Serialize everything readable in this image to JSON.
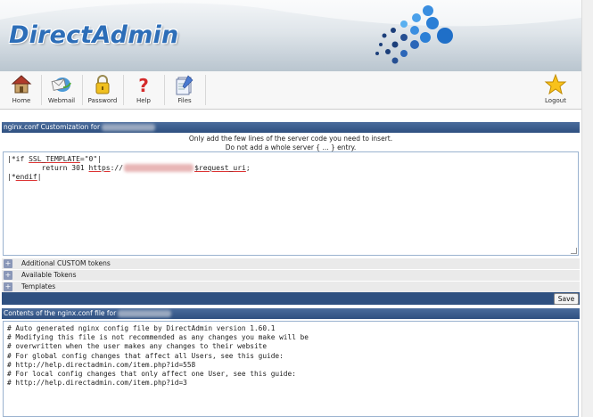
{
  "header": {
    "logo_text": "DirectAdmin"
  },
  "toolbar": {
    "items": [
      {
        "label": "Home",
        "icon": "home-icon"
      },
      {
        "label": "Webmail",
        "icon": "webmail-icon"
      },
      {
        "label": "Password",
        "icon": "padlock-icon"
      },
      {
        "label": "Help",
        "icon": "question-icon"
      },
      {
        "label": "Files",
        "icon": "files-icon"
      }
    ],
    "logout_label": "Logout"
  },
  "customization": {
    "title": "nginx.conf Customization for",
    "info_line1": "Only add the few lines of the server code you need to insert.",
    "info_line2": "Do not add a whole server { ... } entry.",
    "editor_lines": {
      "l1_prefix": "|*if ",
      "l1_token": "SSL_TEMPLATE",
      "l1_suffix": "=\"0\"|",
      "l2_prefix": "        return 301 ",
      "l2_token": "https",
      "l2_mid": "://",
      "l2_var": "$request_uri",
      "l2_end": ";",
      "l3_prefix": "|*",
      "l3_token": "endif",
      "l3_suffix": "|"
    },
    "sections": [
      {
        "label": "Additional CUSTOM tokens"
      },
      {
        "label": "Available Tokens"
      },
      {
        "label": "Templates"
      }
    ],
    "save_label": "Save"
  },
  "contents": {
    "title": "Contents of the nginx.conf file for",
    "lines": [
      "# Auto generated nginx config file by DirectAdmin version 1.60.1",
      "# Modifying this file is not recommended as any changes you make will be",
      "# overwritten when the user makes any changes to their website",
      "",
      "# For global config changes that affect all Users, see this guide:",
      "# http://help.directadmin.com/item.php?id=558",
      "# For local config changes that only affect one User, see this guide:",
      "# http://help.directadmin.com/item.php?id=3"
    ]
  },
  "colors": {
    "bar": "#2f5080",
    "logo": "#2d6eb8",
    "panel_border": "#9ab2cf"
  }
}
